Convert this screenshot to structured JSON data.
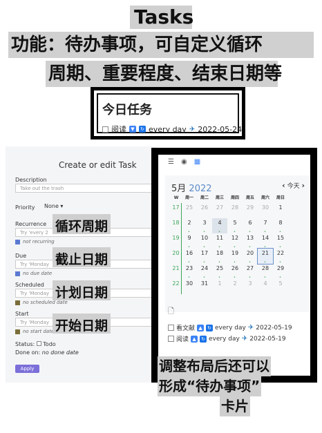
{
  "header": {
    "title": "Tasks",
    "features_line1": "功能：待办事项，可自定义循环",
    "features_line2": "周期、重要程度、结束日期等"
  },
  "today_card": {
    "title": "今日任务",
    "task": {
      "name": "阅读",
      "recurrence": "every day",
      "date": "2022-05-24"
    }
  },
  "edit_form": {
    "title": "Create or edit Task",
    "description_label": "Description",
    "description_placeholder": "Take out the trash",
    "priority_label": "Priority",
    "priority_value": "None",
    "recurrence_label": "Recurrence",
    "recurrence_placeholder": "Try 'every 2",
    "recurrence_hint": "not recurring",
    "due_label": "Due",
    "due_placeholder": "Try 'Monday",
    "due_hint": "no due date",
    "scheduled_label": "Scheduled",
    "scheduled_placeholder": "Try 'Monday",
    "scheduled_hint": "no scheduled date",
    "start_label": "Start",
    "start_placeholder": "Try 'Monday",
    "start_hint": "no start date",
    "status_label": "Status:",
    "status_value": "Todo",
    "done_label": "Done on:",
    "done_value": "no done date",
    "apply_label": "Apply"
  },
  "overlay_labels": {
    "recurrence": "循环周期",
    "due": "截止日期",
    "scheduled": "计划日期",
    "start": "开始日期"
  },
  "calendar": {
    "month": "5月",
    "year": "2022",
    "today_label": "今天",
    "weekdays": [
      "W",
      "周一",
      "周二",
      "周三",
      "周四",
      "周五",
      "周六",
      "周日"
    ],
    "weeks": [
      {
        "wk": "17",
        "days": [
          "25",
          "26",
          "27",
          "28",
          "29",
          "30",
          "1"
        ],
        "dim": [
          true,
          true,
          true,
          true,
          true,
          true,
          false
        ]
      },
      {
        "wk": "18",
        "days": [
          "2",
          "3",
          "4",
          "5",
          "6",
          "7",
          "8"
        ],
        "dim": [
          false,
          false,
          false,
          false,
          false,
          false,
          false
        ]
      },
      {
        "wk": "19",
        "days": [
          "9",
          "10",
          "11",
          "12",
          "13",
          "14",
          "15"
        ],
        "dim": [
          false,
          false,
          false,
          false,
          false,
          false,
          false
        ]
      },
      {
        "wk": "20",
        "days": [
          "16",
          "17",
          "18",
          "19",
          "20",
          "21",
          "22"
        ],
        "dim": [
          false,
          false,
          false,
          false,
          false,
          false,
          false
        ]
      },
      {
        "wk": "21",
        "days": [
          "23",
          "24",
          "25",
          "26",
          "27",
          "28",
          "29"
        ],
        "dim": [
          false,
          false,
          false,
          false,
          false,
          false,
          false
        ]
      },
      {
        "wk": "22",
        "days": [
          "30",
          "31",
          "1",
          "2",
          "3",
          "4",
          "5"
        ],
        "dim": [
          false,
          false,
          true,
          true,
          true,
          true,
          true
        ]
      }
    ],
    "selected_day": "4",
    "today_day": "21"
  },
  "task_list": [
    {
      "name": "看文献",
      "recurrence": "every day",
      "date": "2022-05-19"
    },
    {
      "name": "阅读",
      "recurrence": "every day",
      "date": "2022-05-19"
    }
  ],
  "bottom_note": {
    "line1": "调整布局后还可以",
    "line2": "形成“待办事项”",
    "line3": "卡片"
  }
}
